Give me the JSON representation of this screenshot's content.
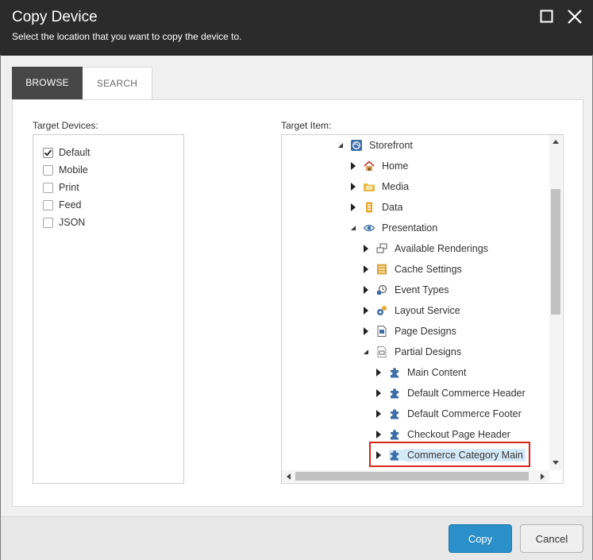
{
  "dialog": {
    "title": "Copy Device",
    "subtitle": "Select the location that you want to copy the device to."
  },
  "tabs": [
    {
      "label": "BROWSE",
      "active": true
    },
    {
      "label": "SEARCH",
      "active": false
    }
  ],
  "devices": {
    "label": "Target Devices:",
    "items": [
      {
        "label": "Default",
        "checked": true
      },
      {
        "label": "Mobile",
        "checked": false
      },
      {
        "label": "Print",
        "checked": false
      },
      {
        "label": "Feed",
        "checked": false
      },
      {
        "label": "JSON",
        "checked": false
      }
    ]
  },
  "tree": {
    "label": "Target Item:",
    "items": [
      {
        "label": "Storefront",
        "icon": "globe-icon",
        "expanded": true
      },
      {
        "label": "Home",
        "icon": "home-icon",
        "expanded": false
      },
      {
        "label": "Media",
        "icon": "media-folder-icon",
        "expanded": false
      },
      {
        "label": "Data",
        "icon": "data-icon",
        "expanded": false
      },
      {
        "label": "Presentation",
        "icon": "eye-icon",
        "expanded": true
      },
      {
        "label": "Available Renderings",
        "icon": "renderings-icon",
        "expanded": false
      },
      {
        "label": "Cache Settings",
        "icon": "cache-icon",
        "expanded": false
      },
      {
        "label": "Event Types",
        "icon": "event-icon",
        "expanded": false
      },
      {
        "label": "Layout Service",
        "icon": "layout-service-icon",
        "expanded": false
      },
      {
        "label": "Page Designs",
        "icon": "page-icon",
        "expanded": false
      },
      {
        "label": "Partial Designs",
        "icon": "partial-icon",
        "expanded": true
      },
      {
        "label": "Main Content",
        "icon": "puzzle-icon",
        "expanded": false
      },
      {
        "label": "Default Commerce Header",
        "icon": "puzzle-icon",
        "expanded": false
      },
      {
        "label": "Default Commerce Footer",
        "icon": "puzzle-icon",
        "expanded": false
      },
      {
        "label": "Checkout Page Header",
        "icon": "puzzle-icon",
        "expanded": false
      },
      {
        "label": "Commerce Category Main",
        "icon": "puzzle-icon",
        "expanded": false,
        "selected": true
      }
    ]
  },
  "buttons": {
    "copy": "Copy",
    "cancel": "Cancel"
  },
  "colors": {
    "accent": "#2b8fc9",
    "titlebar": "#2b2b2b",
    "selection": "#d4eaf7",
    "highlight": "#d6271f"
  }
}
